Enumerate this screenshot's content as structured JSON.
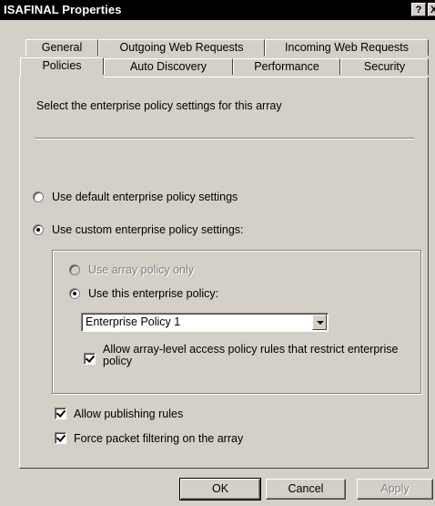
{
  "window": {
    "title": "ISAFINAL Properties",
    "help_label": "?",
    "close_label": "X"
  },
  "tabs_back": [
    "General",
    "Outgoing Web Requests",
    "Incoming Web Requests"
  ],
  "tabs_front": [
    "Policies",
    "Auto Discovery",
    "Performance",
    "Security"
  ],
  "active_tab": "Policies",
  "content": {
    "description": "Select the enterprise policy settings for this array",
    "radio_default": "Use default enterprise policy settings",
    "radio_custom": "Use custom enterprise policy settings:",
    "radio_array_only": "Use array policy only",
    "radio_this_policy": "Use this enterprise policy:",
    "policy_select_value": "Enterprise Policy 1",
    "allow_array_rules_label": "Allow array-level access policy rules that restrict enterprise policy",
    "allow_publishing_label": "Allow publishing rules",
    "force_packet_label": "Force packet filtering on the array"
  },
  "buttons": {
    "ok": "OK",
    "cancel": "Cancel",
    "apply": "Apply"
  }
}
